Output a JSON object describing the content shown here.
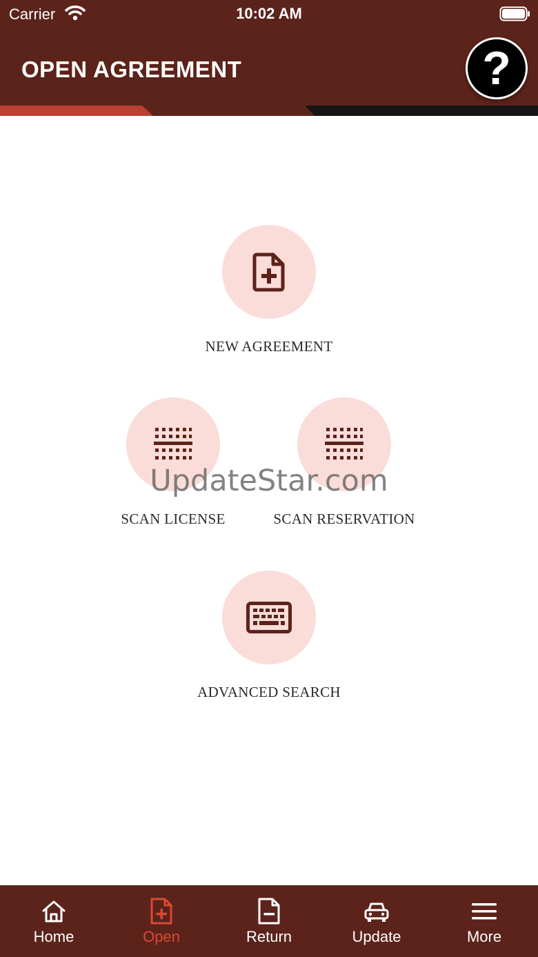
{
  "status_bar": {
    "carrier": "Carrier",
    "time": "10:02 AM"
  },
  "header": {
    "title": "OPEN AGREEMENT",
    "help_glyph": "?",
    "help_icon": "question-mark-icon"
  },
  "actions": {
    "new_agreement": {
      "label": "NEW AGREEMENT",
      "icon": "file-plus-icon"
    },
    "scan_license": {
      "label": "SCAN LICENSE",
      "icon": "barcode-scan-icon"
    },
    "scan_reservation": {
      "label": "SCAN RESERVATION",
      "icon": "barcode-scan-icon"
    },
    "advanced_search": {
      "label": "ADVANCED SEARCH",
      "icon": "keyboard-icon"
    }
  },
  "watermark": "UpdateStar.com",
  "tabs": [
    {
      "label": "Home",
      "icon": "home-icon",
      "active": false
    },
    {
      "label": "Open",
      "icon": "file-plus-icon",
      "active": true
    },
    {
      "label": "Return",
      "icon": "file-minus-icon",
      "active": false
    },
    {
      "label": "Update",
      "icon": "car-icon",
      "active": false
    },
    {
      "label": "More",
      "icon": "menu-icon",
      "active": false
    }
  ],
  "colors": {
    "header_bg": "#5c231b",
    "accent_red": "#c0392b",
    "icon_circle_bg": "#fadcd8",
    "icon_fg": "#5c231b",
    "active_tab": "#d94a33"
  }
}
